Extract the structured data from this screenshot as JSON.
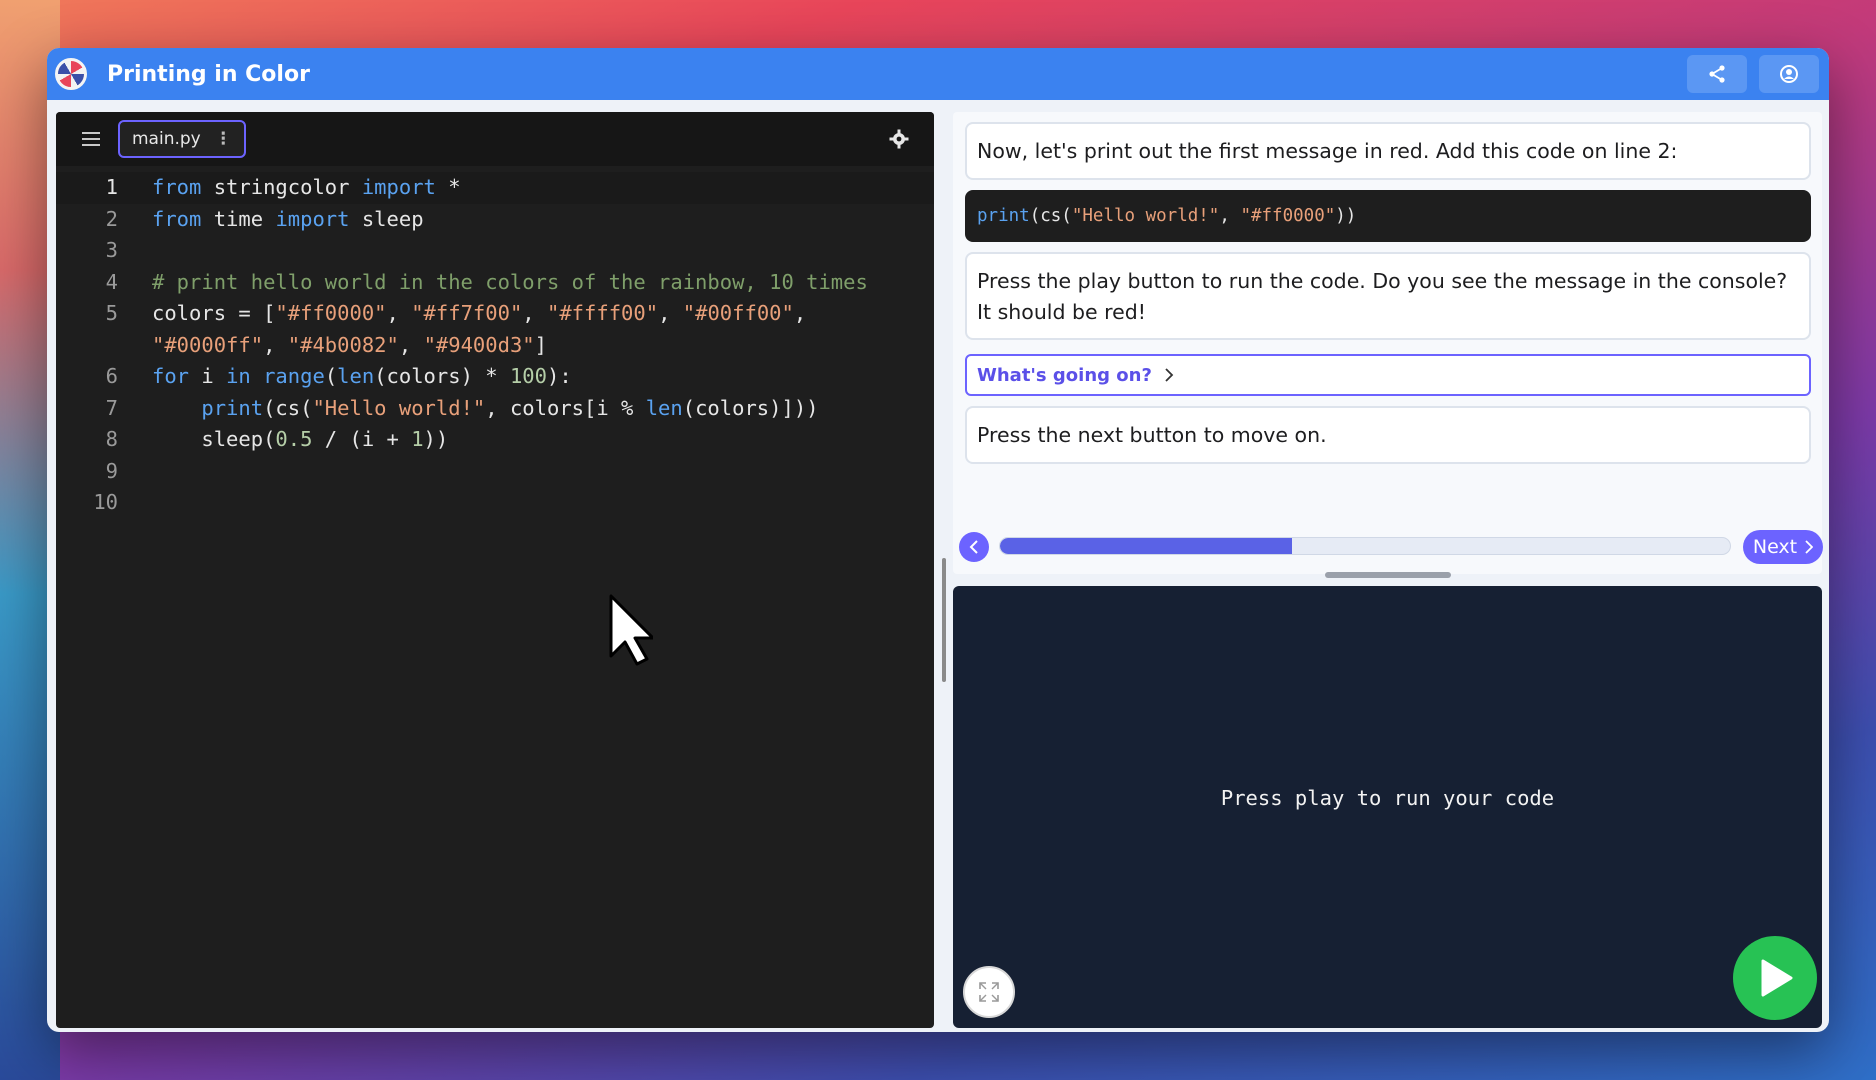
{
  "app": {
    "title": "Printing in Color"
  },
  "header": {
    "share_icon": "share-icon",
    "account_icon": "user-icon"
  },
  "editor": {
    "file_tab": "main.py",
    "lines": [
      {
        "n": "1"
      },
      {
        "n": "2"
      },
      {
        "n": "3"
      },
      {
        "n": "4"
      },
      {
        "n": "5"
      },
      {
        "n": "6"
      },
      {
        "n": "7"
      },
      {
        "n": "8"
      },
      {
        "n": "9"
      },
      {
        "n": "10"
      }
    ],
    "code": {
      "l1": [
        "from",
        " stringcolor ",
        "import",
        " *"
      ],
      "l2": [
        "from",
        " time ",
        "import",
        " sleep"
      ],
      "l4": "# print hello world in the colors of the rainbow, 10 times",
      "l5a": [
        "colors = [",
        "\"#ff0000\"",
        ", ",
        "\"#ff7f00\"",
        ", ",
        "\"#ffff00\"",
        ", ",
        "\"#00ff00\"",
        ","
      ],
      "l5b": [
        "\"#0000ff\"",
        ", ",
        "\"#4b0082\"",
        ", ",
        "\"#9400d3\"",
        "]"
      ],
      "l6": [
        "for",
        " i ",
        "in",
        " ",
        "range",
        "(",
        "len",
        "(colors) * ",
        "100",
        "):"
      ],
      "l7": [
        "    ",
        "print",
        "(cs(",
        "\"Hello world!\"",
        ", colors[i % ",
        "len",
        "(colors)]))"
      ],
      "l8": [
        "    sleep(",
        "0.5",
        " / (i + ",
        "1",
        "))"
      ]
    }
  },
  "instructions": {
    "step1": "Now, let's print out the first message in red. Add this code on line 2:",
    "snippet": [
      "print",
      "(cs(",
      "\"Hello world!\"",
      ", ",
      "\"#ff0000\"",
      "))"
    ],
    "step2": "Press the play button to run the code. Do you see the message in the console? It should be red!",
    "disclosure": "What's going on?",
    "step3": "Press the next button to move on.",
    "next_label": "Next",
    "progress_fraction": 0.4
  },
  "console": {
    "message": "Press play to run your code"
  },
  "colors": {
    "accent": "#6c63ff",
    "header": "#3b82f0",
    "play": "#27c254",
    "editor_bg": "#1e1e1e"
  }
}
